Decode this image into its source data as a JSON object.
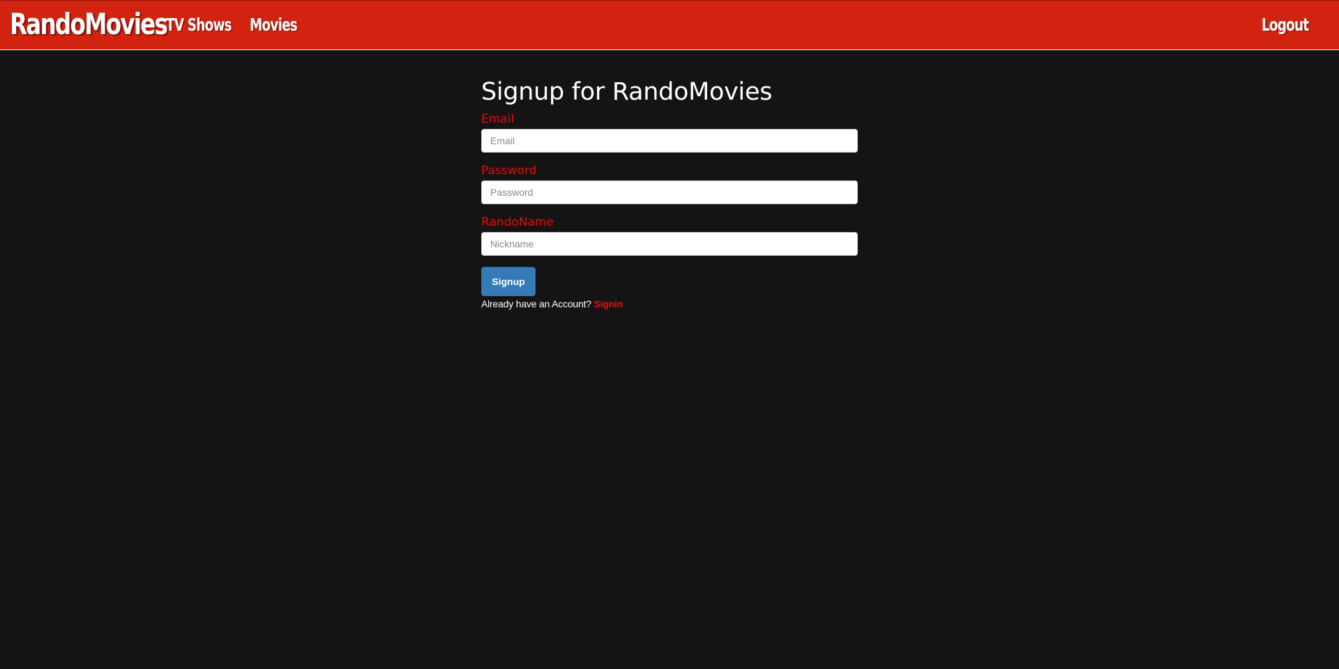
{
  "navbar": {
    "brand": "RandoMovies",
    "links": {
      "tv_shows": "TV Shows",
      "movies": "Movies",
      "logout": "Logout"
    },
    "background_color": "#d1230f"
  },
  "signup_form": {
    "title": "Signup for RandoMovies",
    "email": {
      "label": "Email",
      "placeholder": "Email",
      "value": ""
    },
    "password": {
      "label": "Password",
      "placeholder": "Password",
      "value": ""
    },
    "nickname": {
      "label": "RandoName",
      "placeholder": "Nickname",
      "value": ""
    },
    "submit_label": "Signup",
    "already_text": "Already have an Account?",
    "signin_label": "Signin"
  },
  "colors": {
    "page_background": "#141414",
    "label_red": "#e60b0b",
    "button_blue": "#337ab7"
  }
}
